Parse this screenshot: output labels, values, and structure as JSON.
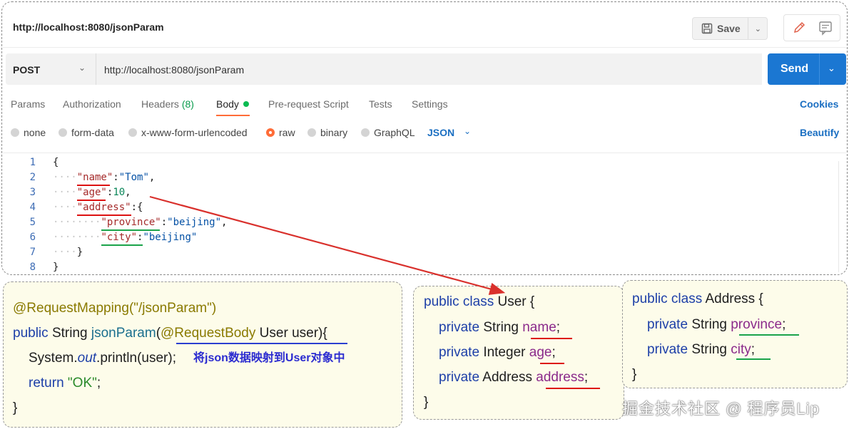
{
  "request": {
    "title_url": "http://localhost:8080/jsonParam",
    "method": "POST",
    "url": "http://localhost:8080/jsonParam",
    "save_label": "Save",
    "send_label": "Send"
  },
  "tabs": {
    "params": "Params",
    "authorization": "Authorization",
    "headers": "Headers",
    "headers_count": "(8)",
    "body": "Body",
    "prerequest": "Pre-request Script",
    "tests": "Tests",
    "settings": "Settings",
    "cookies": "Cookies"
  },
  "body_types": {
    "none": "none",
    "form_data": "form-data",
    "urlencoded": "x-www-form-urlencoded",
    "raw": "raw",
    "binary": "binary",
    "graphql": "GraphQL",
    "format": "JSON",
    "beautify": "Beautify",
    "selected": "raw"
  },
  "editor": {
    "line_numbers": [
      "1",
      "2",
      "3",
      "4",
      "5",
      "6",
      "7",
      "8"
    ],
    "json": {
      "open_brace": "{",
      "name_key": "\"name\"",
      "name_value": "\"Tom\"",
      "age_key": "\"age\"",
      "age_value": "10",
      "address_key": "\"address\"",
      "province_key": "\"province\"",
      "province_value": "\"beijing\"",
      "city_key": "\"city\"",
      "city_value": "\"beijing\"",
      "close_inner": "}",
      "close_brace": "}"
    }
  },
  "controller": {
    "annotation": "@RequestMapping(\"/jsonParam\")",
    "kw_public": "public",
    "return_type": "String",
    "method_name": "jsonParam",
    "paren_open": "(",
    "param_annotation": "@RequestBody",
    "param": "User user){",
    "println_prefix": "System.",
    "println_out": "out",
    "println_suffix": ".println(user);",
    "note": "将json数据映射到User对象中",
    "kw_return": "return",
    "return_value": "\"OK\"",
    "semicolon": ";",
    "close": "}"
  },
  "user_class": {
    "header_kw": "public class",
    "header_name": "User {",
    "kw_private": "private",
    "f1_type": "String",
    "f1_name": "name",
    "f2_type": "Integer",
    "f2_name": "age",
    "f3_type": "Address",
    "f3_name": "address",
    "semicolon": ";",
    "close": "}"
  },
  "address_class": {
    "header_kw": "public class",
    "header_name": "Address {",
    "kw_private": "private",
    "f1_type": "String",
    "f1_name": "province",
    "f2_type": "String",
    "f2_name": "city",
    "semicolon": ";",
    "close": "}"
  },
  "watermark": "掘金技术社区 @ 程序员Lip",
  "colors": {
    "send": "#1b77d2",
    "accent_orange": "#ff6c37",
    "link_blue": "#1b6fc2",
    "arrow_red": "#d9302c",
    "box_yellow": "#fdfcea"
  },
  "icons": [
    "save-icon",
    "chevron-down-icon",
    "pencil-icon",
    "comment-icon",
    "arrow-icon"
  ]
}
